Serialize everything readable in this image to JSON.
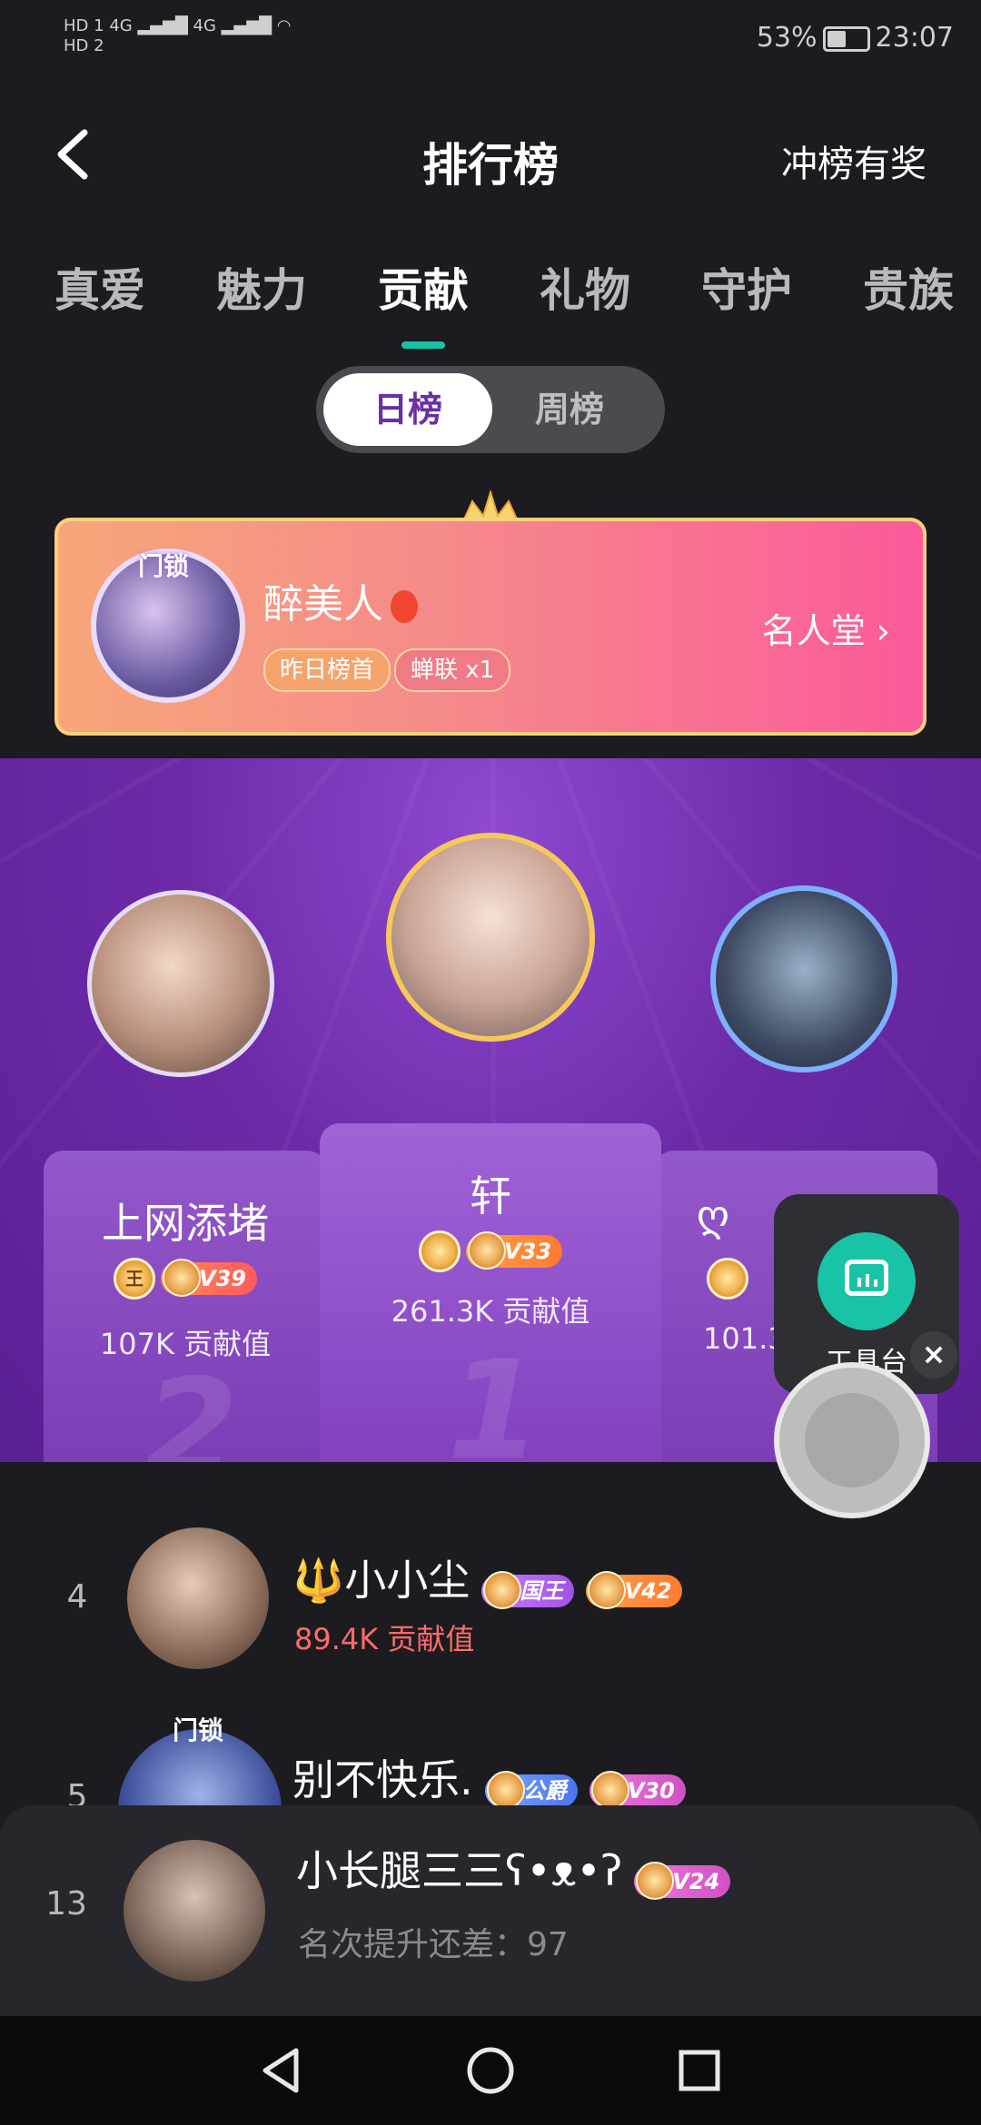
{
  "status": {
    "hd1": "HD 1",
    "hd2": "HD 2",
    "net1": "4G",
    "net2": "4G",
    "battery": "53%",
    "time": "23:07"
  },
  "header": {
    "title": "排行榜",
    "reward": "冲榜有奖"
  },
  "tabs": [
    "真爱",
    "魅力",
    "贡献",
    "礼物",
    "守护",
    "贵族"
  ],
  "active_tab": "贡献",
  "segment": {
    "day": "日榜",
    "week": "周榜"
  },
  "banner": {
    "lock_text": "门锁",
    "name": "醉美人",
    "tag1": "昨日榜首",
    "tag2": "蝉联 x1",
    "hall": "名人堂"
  },
  "podium": {
    "first": {
      "rank": "1",
      "name": "轩",
      "level": "V33",
      "value": "261.3K 贡献值"
    },
    "second": {
      "rank": "2",
      "name": "上网添堵",
      "noble": "王",
      "level": "V39",
      "value": "107K 贡献值"
    },
    "third": {
      "name": "ღ",
      "value": "101.3"
    }
  },
  "tool": {
    "label": "工具台"
  },
  "list": [
    {
      "rank": "4",
      "name": "🔱小小尘",
      "noble": "国王",
      "level": "V42",
      "value": "89.4K 贡献值"
    },
    {
      "rank": "5",
      "lock_text": "门锁",
      "name": "别不快乐.",
      "noble": "公爵",
      "level": "V30"
    }
  ],
  "me": {
    "rank": "13",
    "name": "小长腿三三ʕ•ᴥ•ʔ",
    "level": "V24",
    "hint": "名次提升还差：97"
  }
}
